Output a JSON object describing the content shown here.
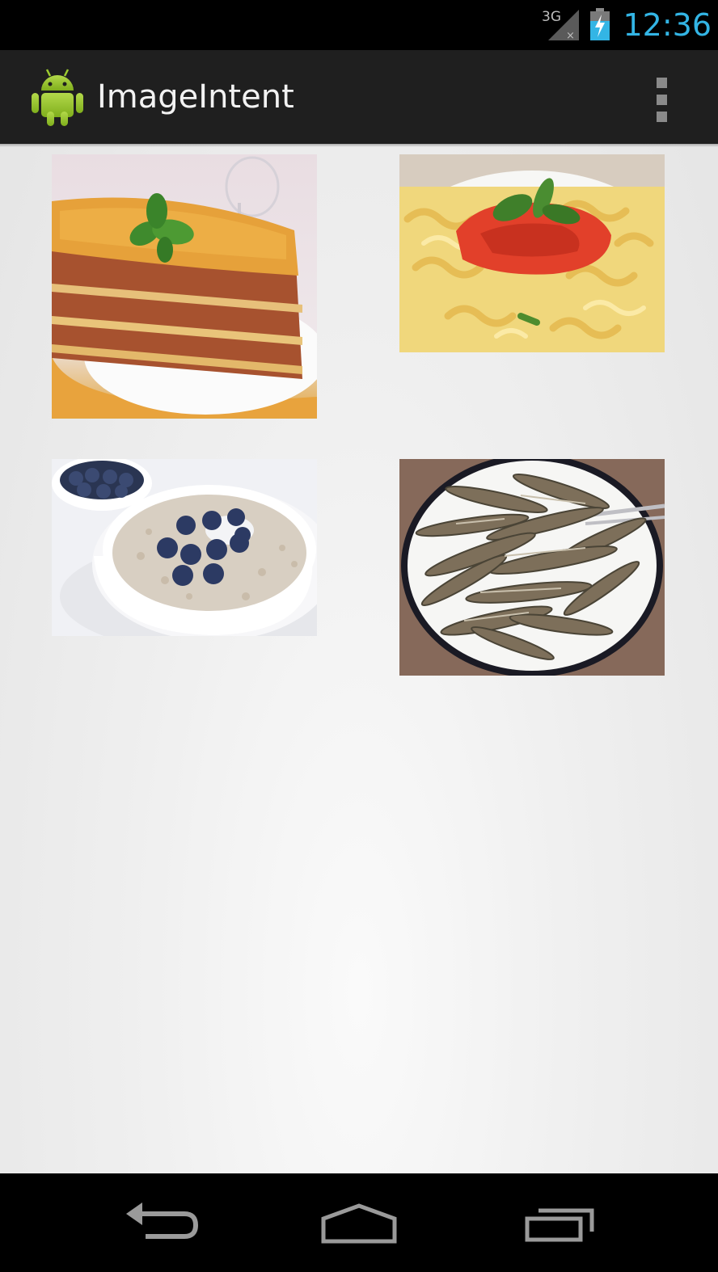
{
  "status_bar": {
    "time": "12:36",
    "network_label": "3G",
    "network_icon": "signal-3g-no-data-icon",
    "battery_icon": "battery-charging-icon",
    "accent_color": "#33b5e5"
  },
  "action_bar": {
    "title": "ImageIntent",
    "app_icon": "android-robot-icon",
    "menu_icon": "overflow-menu-icon"
  },
  "grid": {
    "items": [
      {
        "subject": "lasagna-photo"
      },
      {
        "subject": "pasta-with-tomato-sauce-photo"
      },
      {
        "subject": "oatmeal-with-blueberries-photo"
      },
      {
        "subject": "fried-anchovies-photo"
      }
    ]
  },
  "navigation_bar": {
    "back_icon": "back-icon",
    "home_icon": "home-icon",
    "recents_icon": "recent-apps-icon"
  }
}
